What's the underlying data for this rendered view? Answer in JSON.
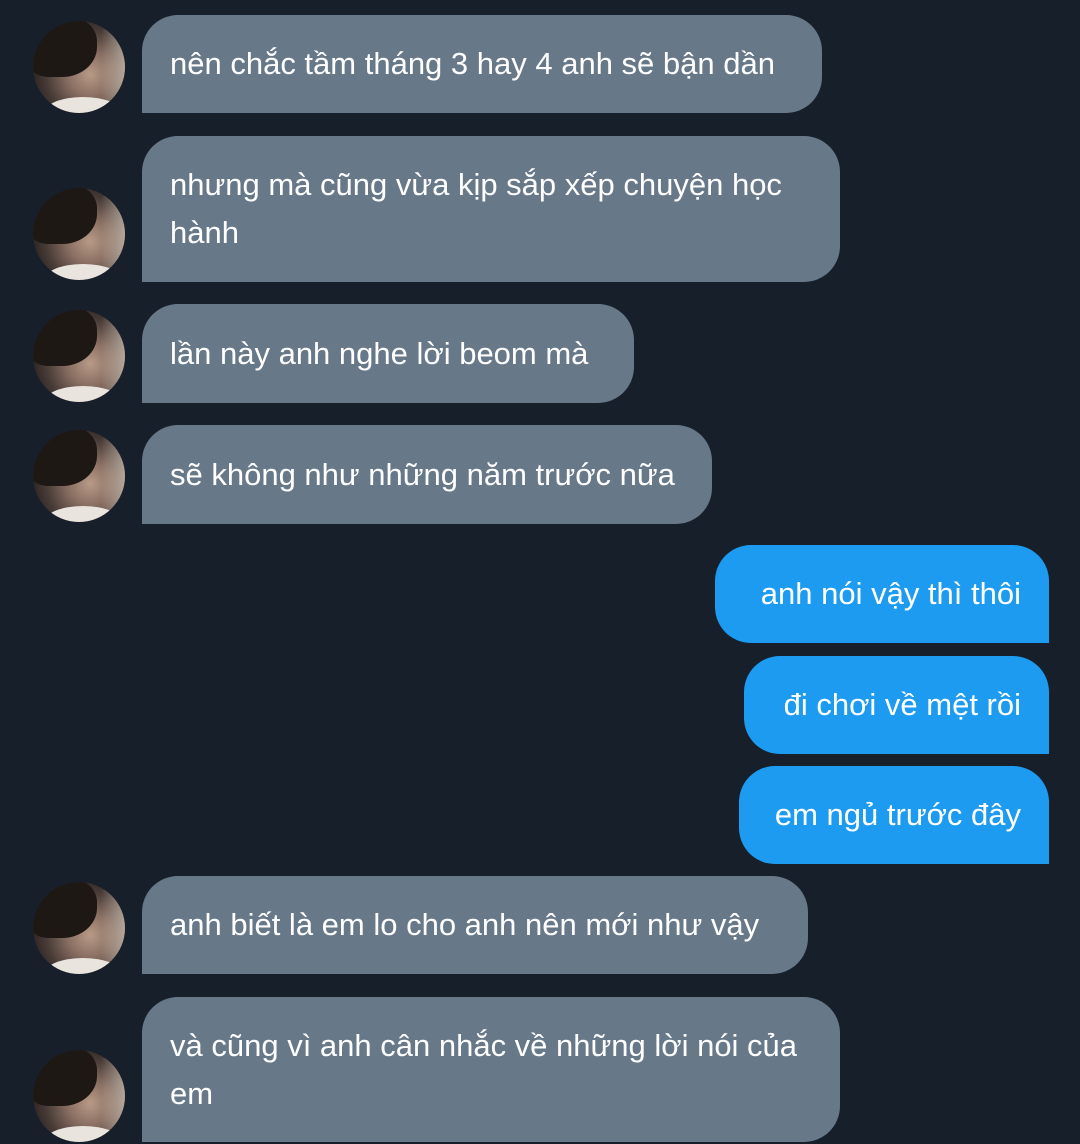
{
  "conversation": {
    "messages": [
      {
        "direction": "in",
        "text": "nên chắc tầm tháng 3 hay 4 anh sẽ bận dần"
      },
      {
        "direction": "in",
        "text": "nhưng mà cũng vừa kịp sắp xếp chuyện học hành"
      },
      {
        "direction": "in",
        "text": "lần này anh nghe lời beom mà"
      },
      {
        "direction": "in",
        "text": "sẽ không như những năm trước nữa"
      },
      {
        "direction": "out",
        "text": "anh nói vậy thì thôi"
      },
      {
        "direction": "out",
        "text": "đi chơi về mệt rồi"
      },
      {
        "direction": "out",
        "text": "em ngủ trước đây"
      },
      {
        "direction": "in",
        "text": "anh biết là em lo cho anh nên mới như vậy"
      },
      {
        "direction": "in",
        "text": "và cũng vì anh cân nhắc về những lời nói của em"
      }
    ]
  },
  "colors": {
    "background": "#161f2a",
    "incoming_bubble": "#677889",
    "outgoing_bubble": "#1d9bf0",
    "text": "#ffffff"
  },
  "icons": {
    "avatar": "contact-avatar-photo"
  }
}
